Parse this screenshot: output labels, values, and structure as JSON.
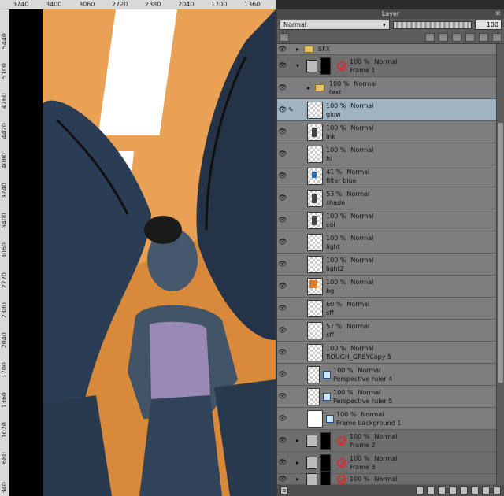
{
  "ruler_top": [
    "3740",
    "3400",
    "3060",
    "2720",
    "2380",
    "2040",
    "1700",
    "1360"
  ],
  "ruler_left": [
    "5440",
    "5100",
    "4760",
    "4420",
    "4080",
    "3740",
    "3400",
    "3060",
    "2720",
    "2380",
    "2040",
    "1700",
    "1360",
    "1020",
    "680",
    "340"
  ],
  "panel": {
    "title": "Layer",
    "close": "✕",
    "blend_mode": "Normal",
    "opacity": "100"
  },
  "layers": [
    {
      "kind": "folder",
      "indent": 0,
      "opacity": "",
      "mode": "",
      "name": "SFX",
      "partial": true
    },
    {
      "kind": "frame",
      "indent": 0,
      "opacity": "100 %",
      "mode": "Normal",
      "name": "Frame 1",
      "expanded": true
    },
    {
      "kind": "folder",
      "indent": 1,
      "opacity": "100 %",
      "mode": "Normal",
      "name": "text"
    },
    {
      "kind": "raster",
      "indent": 1,
      "opacity": "100 %",
      "mode": "Normal",
      "name": "glow",
      "selected": true,
      "thumb": ""
    },
    {
      "kind": "raster",
      "indent": 1,
      "opacity": "100 %",
      "mode": "Normal",
      "name": "ink",
      "thumb": "ink"
    },
    {
      "kind": "raster",
      "indent": 1,
      "opacity": "100 %",
      "mode": "Normal",
      "name": "hi",
      "thumb": ""
    },
    {
      "kind": "raster",
      "indent": 1,
      "opacity": "41 %",
      "mode": "Normal",
      "name": "filter blue",
      "thumb": "blue"
    },
    {
      "kind": "raster",
      "indent": 1,
      "opacity": "53 %",
      "mode": "Normal",
      "name": "shade",
      "thumb": "ink"
    },
    {
      "kind": "raster",
      "indent": 1,
      "opacity": "100 %",
      "mode": "Normal",
      "name": "col",
      "thumb": "ink"
    },
    {
      "kind": "raster",
      "indent": 1,
      "opacity": "100 %",
      "mode": "Normal",
      "name": "light",
      "thumb": ""
    },
    {
      "kind": "raster",
      "indent": 1,
      "opacity": "100 %",
      "mode": "Normal",
      "name": "light2",
      "thumb": ""
    },
    {
      "kind": "raster",
      "indent": 1,
      "opacity": "100 %",
      "mode": "Normal",
      "name": "bg",
      "thumb": "orange"
    },
    {
      "kind": "raster",
      "indent": 1,
      "opacity": "60 %",
      "mode": "Normal",
      "name": "sff",
      "thumb": ""
    },
    {
      "kind": "raster",
      "indent": 1,
      "opacity": "57 %",
      "mode": "Normal",
      "name": "sff",
      "thumb": ""
    },
    {
      "kind": "raster",
      "indent": 1,
      "opacity": "100 %",
      "mode": "Normal",
      "name": "ROUGH_GREYCopy 5",
      "thumb": ""
    },
    {
      "kind": "ruler",
      "indent": 1,
      "opacity": "100 %",
      "mode": "Normal",
      "name": "Perspective ruler 4"
    },
    {
      "kind": "ruler",
      "indent": 1,
      "opacity": "100 %",
      "mode": "Normal",
      "name": "Perspective ruler 5"
    },
    {
      "kind": "paper",
      "indent": 1,
      "opacity": "100 %",
      "mode": "Normal",
      "name": "Frame background 1"
    },
    {
      "kind": "frame",
      "indent": 0,
      "opacity": "100 %",
      "mode": "Normal",
      "name": "Frame 2"
    },
    {
      "kind": "frame",
      "indent": 0,
      "opacity": "100 %",
      "mode": "Normal",
      "name": "Frame 3"
    },
    {
      "kind": "frame",
      "indent": 0,
      "opacity": "100 %",
      "mode": "Normal",
      "name": "",
      "partial": true
    }
  ]
}
